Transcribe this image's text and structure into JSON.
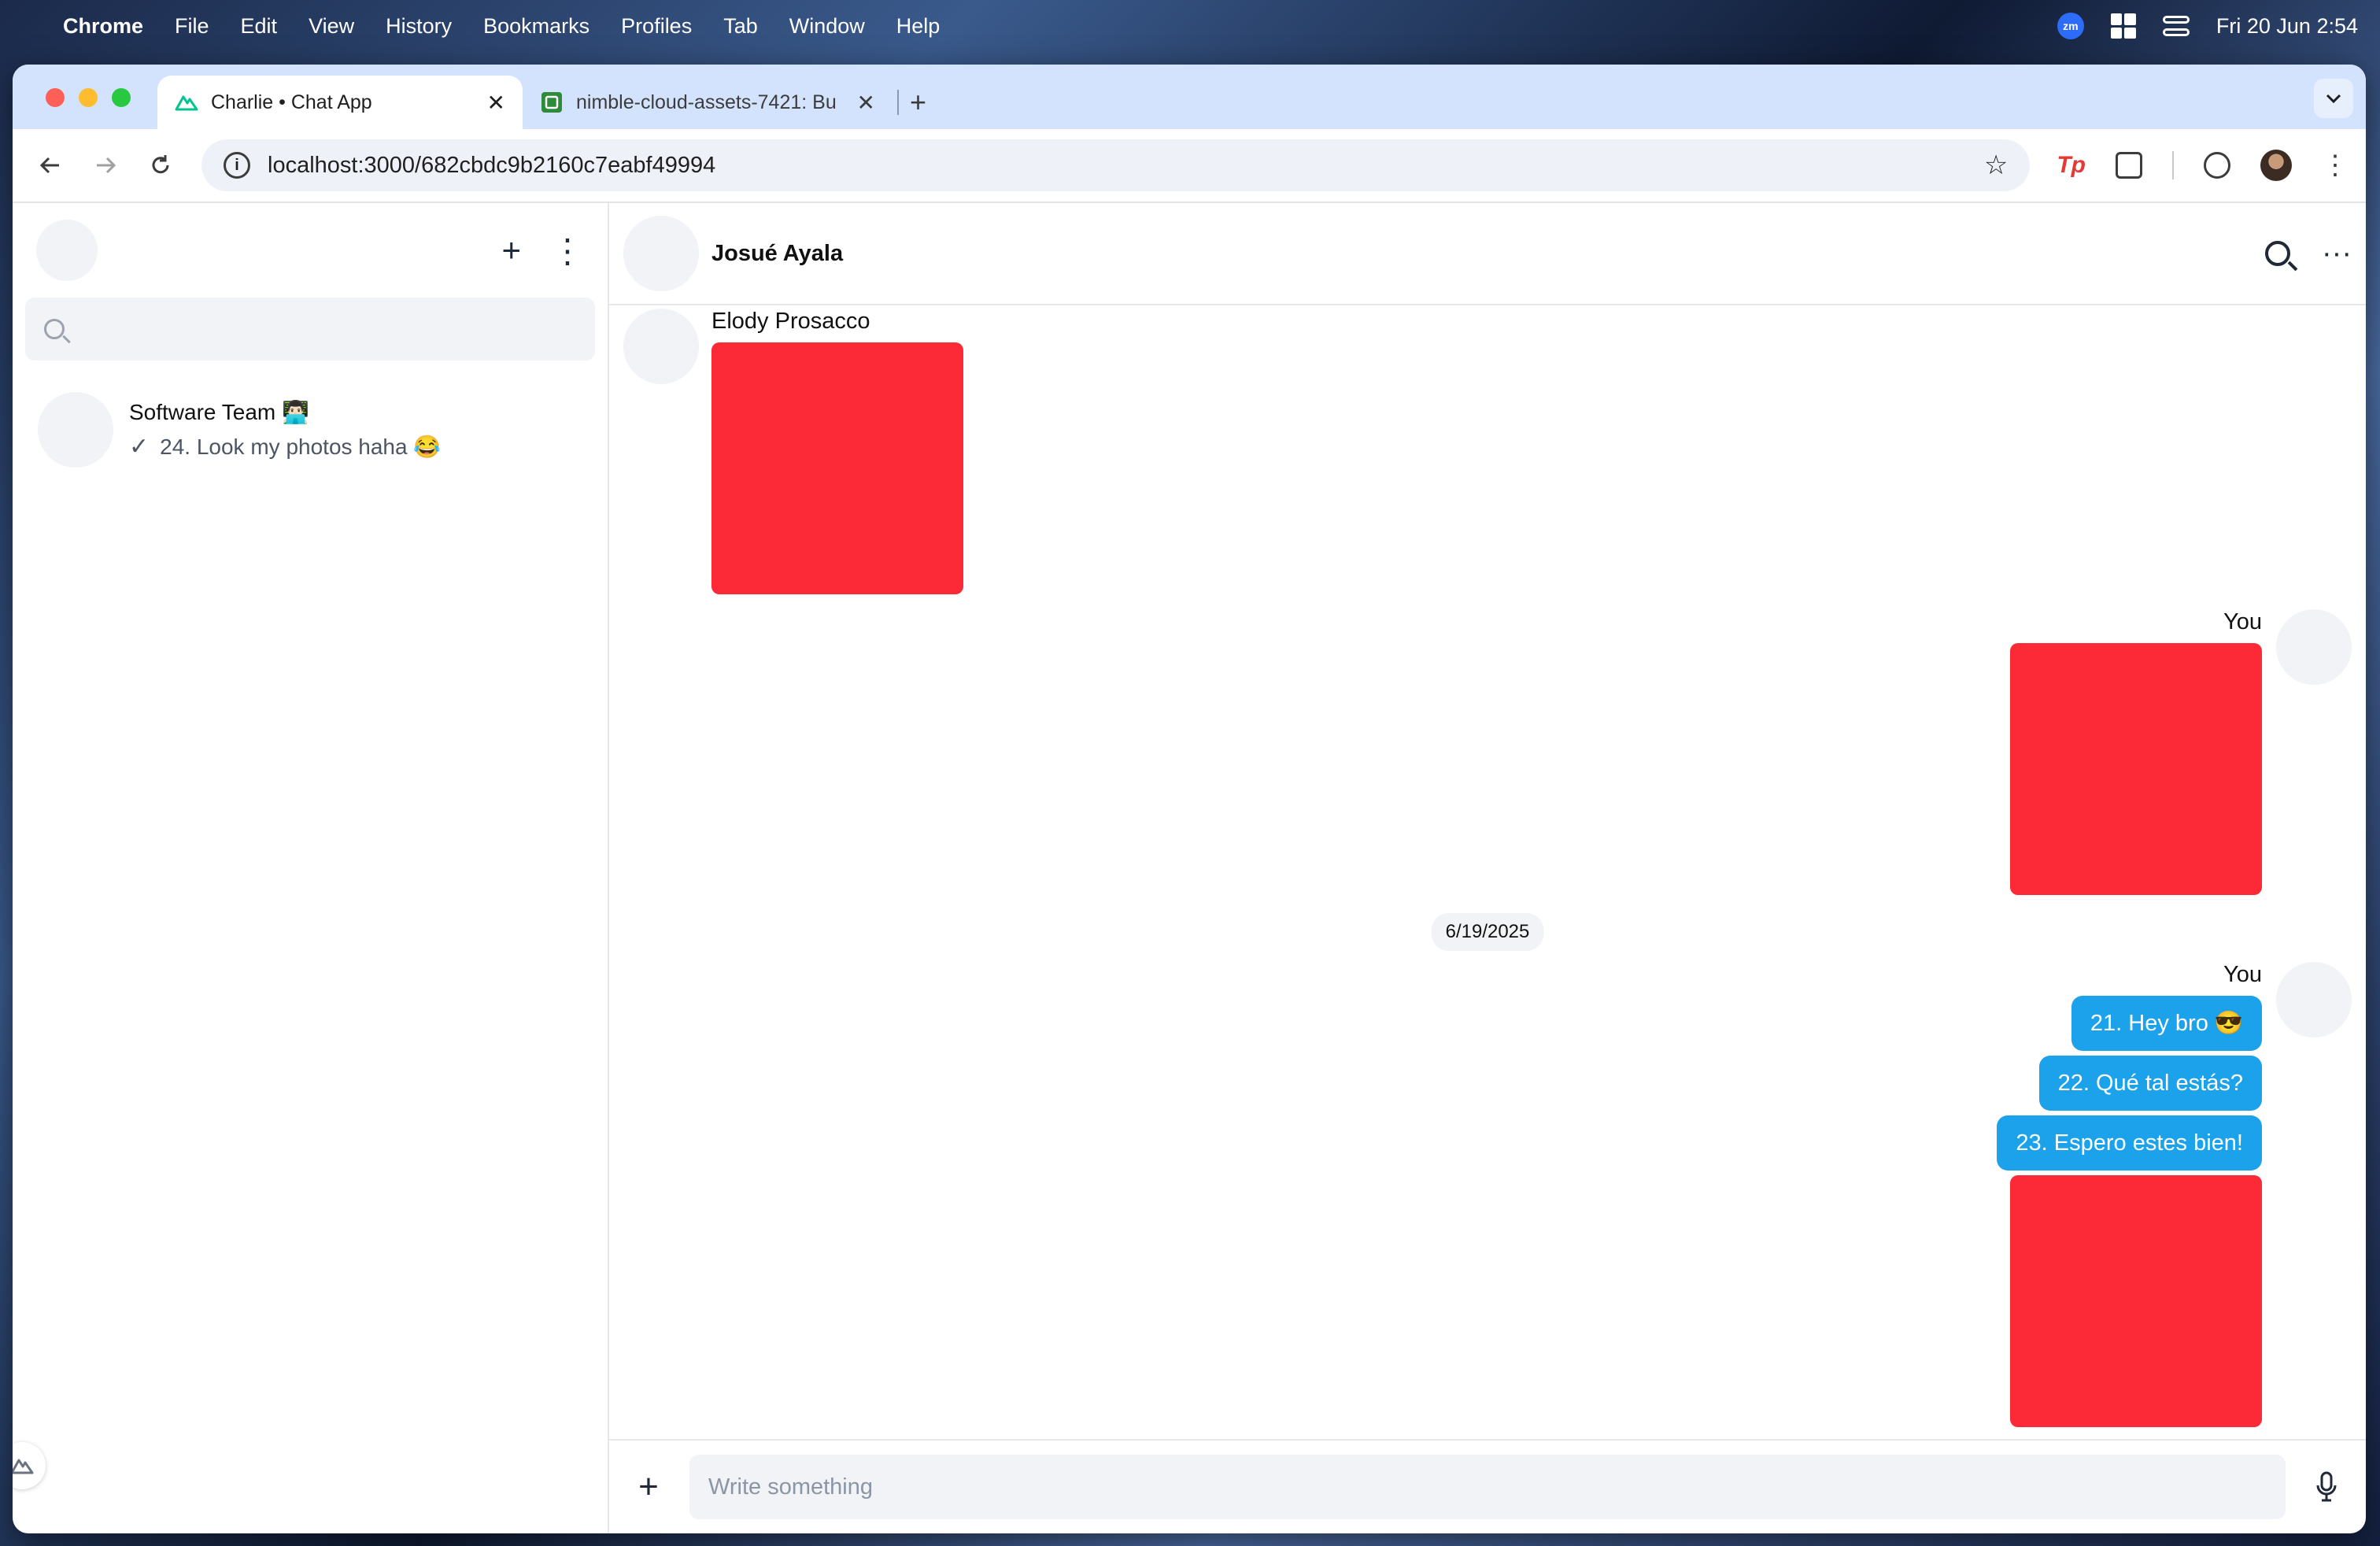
{
  "menubar": {
    "app": "Chrome",
    "items": [
      "File",
      "Edit",
      "View",
      "History",
      "Bookmarks",
      "Profiles",
      "Tab",
      "Window",
      "Help"
    ],
    "zoom_badge": "zm",
    "clock": "Fri 20 Jun  2:54"
  },
  "browser": {
    "tabs": [
      {
        "title": "Charlie • Chat App",
        "close": "✕"
      },
      {
        "title": "nimble-cloud-assets-7421: Bu",
        "close": "✕"
      }
    ],
    "new_tab": "+",
    "url": "localhost:3000/682cbdc9b2160c7eabf49994",
    "ext_tp": "Tp"
  },
  "sidebar": {
    "new_chat": "+",
    "menu": "⋮",
    "search_placeholder": "",
    "chats": [
      {
        "name": "Software Team 👨🏻‍💻",
        "preview": "24. Look my photos haha 😂",
        "status": "✓"
      }
    ]
  },
  "conversation": {
    "title": "Josué Ayala",
    "more": "···",
    "messages": {
      "first_sender": "Elody Prosacco",
      "self_label_1": "You",
      "date_separator": "6/19/2025",
      "self_label_2": "You",
      "bubbles": [
        "21. Hey bro 😎",
        "22. Qué tal estás?",
        "23. Espero estes bien!"
      ]
    },
    "composer": {
      "attach": "+",
      "placeholder": "Write something"
    }
  },
  "colors": {
    "bubble": "#1ba2ea",
    "image_placeholder": "#fc2a37",
    "tabstrip": "#d3e3fd"
  }
}
